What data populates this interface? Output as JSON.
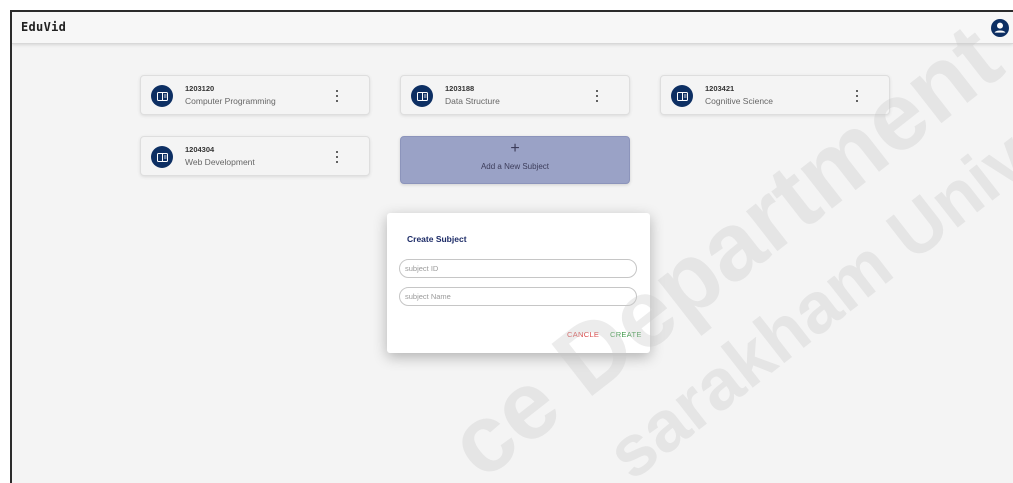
{
  "app": {
    "title": "EduVid"
  },
  "header": {
    "account_icon": "account-circle-icon"
  },
  "subjects": [
    {
      "id": "1203120",
      "name": "Computer Programming"
    },
    {
      "id": "1203188",
      "name": "Data Structure"
    },
    {
      "id": "1203421",
      "name": "Cognitive Science"
    },
    {
      "id": "1204304",
      "name": "Web Development"
    }
  ],
  "add_card": {
    "icon": "+",
    "label": "Add a New Subject"
  },
  "dialog": {
    "title": "Create Subject",
    "subject_id_placeholder": "subject ID",
    "subject_name_placeholder": "subject Name",
    "cancel_label": "CANCLE",
    "create_label": "CREATE"
  },
  "watermark": {
    "line1": "ce Department",
    "line2": "sarakham Univers"
  },
  "colors": {
    "badge": "#0d2f63",
    "dialog_title": "#1b2a66",
    "cancel": "#d94848",
    "create": "#3f9a4a",
    "add_card": "#9aa2c6"
  }
}
